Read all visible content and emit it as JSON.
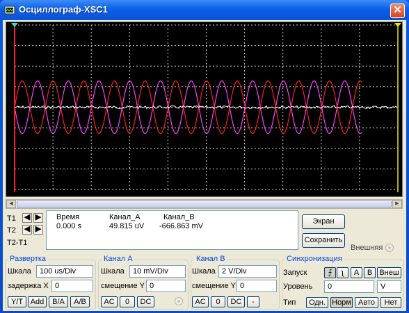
{
  "window": {
    "title": "Осциллограф-XSC1",
    "close_glyph": "✕",
    "icon": "oscilloscope-icon"
  },
  "screen": {
    "background": "#000000",
    "grid_color": "#cfcfcf",
    "channel_a_color": "#ff2020",
    "channel_b_color": "#ff40ff",
    "trace_noise_color": "#ffffff",
    "cursor_t1_color": "#ff2020",
    "cursor_t2_color": "#e8e800",
    "cursor_marker_color": "#20e0e0"
  },
  "time_cursors": {
    "t1_label": "T1",
    "t2_label": "T2",
    "diff_label": "T2-T1",
    "left_arrow": "◀",
    "right_arrow": "▶"
  },
  "readout": {
    "time_header": "Время",
    "channel_a_header": "Канал_A",
    "channel_b_header": "Канал_B",
    "time_value": "0.000 s",
    "channel_a_value": "49.815 uV",
    "channel_b_value": "-666.863 mV"
  },
  "actions": {
    "screen_button": "Экран",
    "save_button": "Сохранить",
    "external_label": "Внешняя"
  },
  "timebase": {
    "legend": "Развертка",
    "scale_label": "Шкала",
    "scale_value": "100 us/Div",
    "delay_label": "задержка X",
    "delay_value": "0",
    "mode_buttons": [
      "Y/T",
      "Add",
      "B/A",
      "A/B"
    ]
  },
  "channel_a": {
    "legend": "Канал A",
    "scale_label": "Шкала",
    "scale_value": "10 mV/Div",
    "offset_label": "смещение Y",
    "offset_value": "0",
    "coupling_buttons": [
      "AC",
      "0",
      "DC"
    ]
  },
  "channel_b": {
    "legend": "Канал B",
    "scale_label": "Шкала",
    "scale_value": "2  V/Div",
    "offset_label": "смещение Y",
    "offset_value": "0",
    "coupling_buttons": [
      "AC",
      "0",
      "DC",
      "-"
    ]
  },
  "trigger": {
    "legend": "Синхронизация",
    "edge_label": "Запуск",
    "edge_rising": "⨍",
    "edge_falling": "ʅ",
    "source_a": "A",
    "source_b": "B",
    "source_ext": "Внеш",
    "level_label": "Уровень",
    "level_value": "0",
    "level_unit": "V",
    "type_label": "Тип",
    "type_buttons": [
      "Одн.",
      "Норм",
      "Авто",
      "Нет"
    ]
  }
}
